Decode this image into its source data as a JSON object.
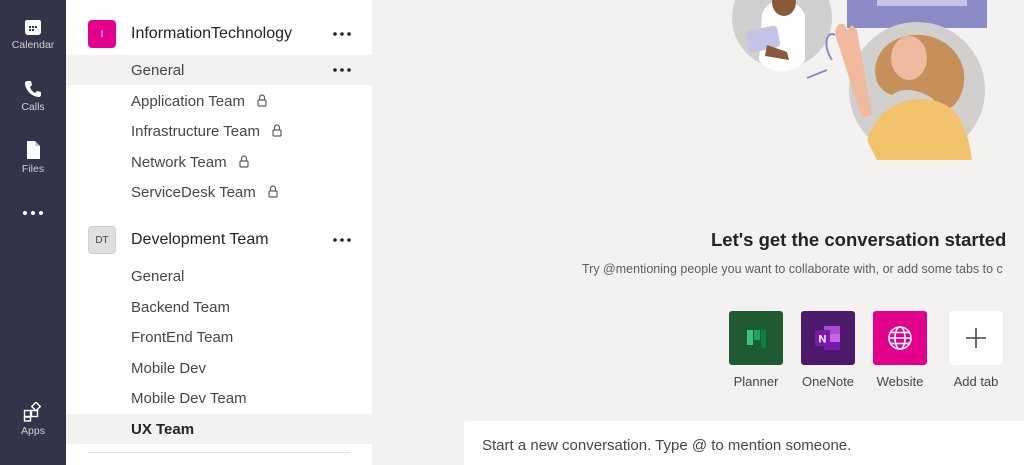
{
  "rail": {
    "items": [
      {
        "label": "Calendar",
        "icon": "calendar-icon"
      },
      {
        "label": "Calls",
        "icon": "phone-icon"
      },
      {
        "label": "Files",
        "icon": "file-icon"
      },
      {
        "label": "",
        "icon": "more-apps-icon"
      },
      {
        "label": "Apps",
        "icon": "apps-icon"
      }
    ]
  },
  "teams": [
    {
      "name": "InformationTechnology",
      "avatar_text": "I",
      "avatar_color": "#e3008c",
      "channels": [
        {
          "label": "General",
          "private": false
        },
        {
          "label": "Application Team",
          "private": true
        },
        {
          "label": "Infrastructure Team",
          "private": true
        },
        {
          "label": "Network Team",
          "private": true
        },
        {
          "label": "ServiceDesk Team",
          "private": true
        }
      ]
    },
    {
      "name": "Development Team",
      "avatar_text": "DT",
      "avatar_color": "#e1dfdd",
      "channels": [
        {
          "label": "General",
          "private": false
        },
        {
          "label": "Backend Team",
          "private": false
        },
        {
          "label": "FrontEnd Team",
          "private": false
        },
        {
          "label": "Mobile Dev",
          "private": false
        },
        {
          "label": "Mobile Dev Team",
          "private": false
        },
        {
          "label": "UX Team",
          "private": false,
          "selected": true
        }
      ]
    }
  ],
  "main": {
    "headline": "Let's get the conversation started",
    "subline": "Try @mentioning people you want to collaborate with, or add some tabs to c",
    "tiles": [
      {
        "label": "Planner",
        "icon": "planner-icon",
        "color": "#1f5a33"
      },
      {
        "label": "OneNote",
        "icon": "onenote-icon",
        "color": "#5c2d91"
      },
      {
        "label": "Website",
        "icon": "globe-icon",
        "color": "#e3008c"
      },
      {
        "label": "Add tab",
        "icon": "plus-icon",
        "color": "#ffffff"
      }
    ],
    "composer_placeholder": "Start a new conversation. Type @ to mention someone."
  }
}
